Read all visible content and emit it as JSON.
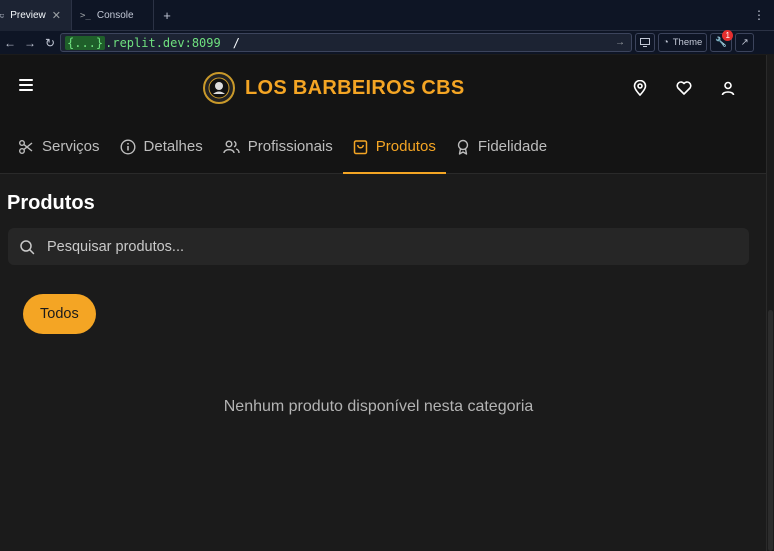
{
  "ide": {
    "tabs": [
      {
        "label": "Preview",
        "icon": "monitor-icon"
      },
      {
        "label": "Console",
        "icon": "terminal-icon"
      }
    ],
    "new_tab": "+",
    "menu": "⋮"
  },
  "addressbar": {
    "host": "{...}",
    "domain": ".replit.dev:8099",
    "path": "/",
    "theme_label": "Theme",
    "devtools_badge": "1"
  },
  "header": {
    "brand": "LOS BARBEIROS CBS",
    "icons": [
      "map-pin-icon",
      "heart-icon",
      "user-icon"
    ]
  },
  "tabs": [
    {
      "label": "Serviços",
      "icon": "scissors-icon"
    },
    {
      "label": "Detalhes",
      "icon": "info-icon"
    },
    {
      "label": "Profissionais",
      "icon": "users-icon"
    },
    {
      "label": "Produtos",
      "icon": "shopping-bag-icon",
      "active": true
    },
    {
      "label": "Fidelidade",
      "icon": "award-icon"
    }
  ],
  "main": {
    "title": "Produtos",
    "search_placeholder": "Pesquisar produtos...",
    "filter_chip": "Todos",
    "empty_message": "Nenhum produto disponível nesta categoria"
  },
  "colors": {
    "accent": "#f4a524",
    "background": "#1b1b1b",
    "header": "#141414"
  }
}
